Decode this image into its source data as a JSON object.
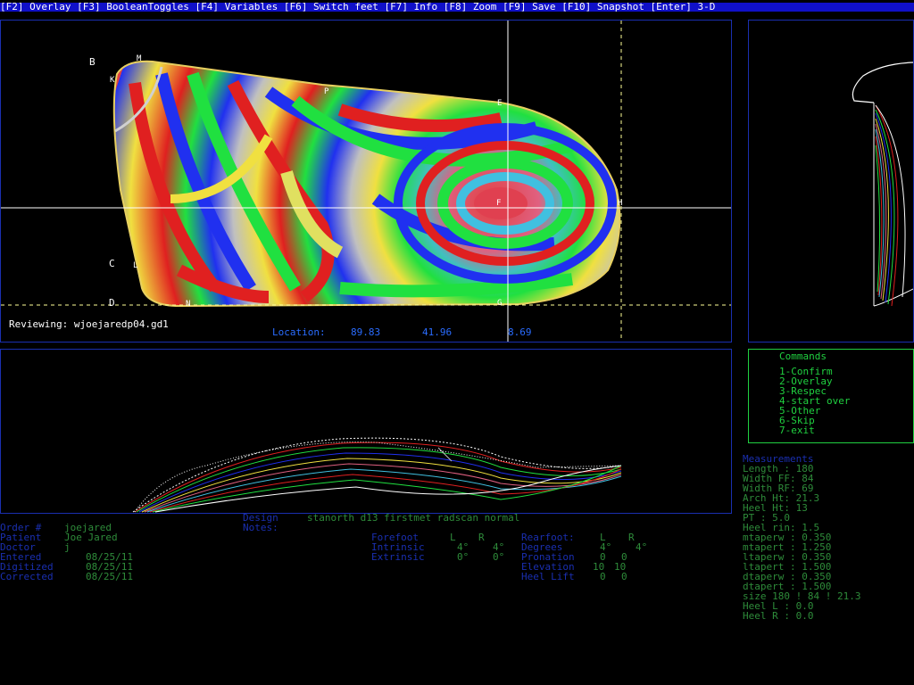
{
  "menubar": {
    "items": [
      "[F2] Overlay",
      "[F3] BooleanToggles",
      "[F4] Variables",
      "[F6] Switch feet",
      "[F7] Info",
      "[F8] Zoom",
      "[F9] Save",
      "[F10] Snapshot",
      "[Enter] 3-D"
    ]
  },
  "plantar": {
    "reviewing": "Reviewing: wjoejaredp04.gd1",
    "location_label": "Location:",
    "location_x": "89.83",
    "location_y": "41.96",
    "location_z": "8.69",
    "landmarks": [
      "B",
      "M",
      "K",
      "P",
      "E",
      "F",
      "H",
      "C",
      "L",
      "D",
      "N",
      "G"
    ]
  },
  "commands": {
    "title": "Commands",
    "items": [
      "1-Confirm",
      "2-Overlay",
      "3-Respec",
      "4-start over",
      "5-Other",
      "6-Skip",
      "7-exit"
    ]
  },
  "measurements": {
    "title": "Measurements",
    "lines": [
      "Length  :  180",
      "Width FF:  84",
      "Width RF:  69",
      "Arch Ht:  21.3",
      "Heel Ht:   13",
      "PT      : 5.0",
      "Heel rin: 1.5",
      "mtaperw : 0.350",
      "mtapert : 1.250",
      "ltaperw : 0.350",
      "ltapert : 1.500",
      "dtaperw : 0.350",
      "dtapert : 1.500",
      "size  180 ! 84 ! 21.3",
      "Heel L :  0.0",
      "Heel R :  0.0"
    ]
  },
  "order": {
    "labels": [
      "Order #",
      "Patient",
      "Doctor",
      "Entered",
      "Digitized",
      "Corrected"
    ],
    "values": [
      "joejared",
      "Joe Jared",
      "j",
      "08/25/11",
      "08/25/11",
      "08/25/11"
    ]
  },
  "design": {
    "label": "Design",
    "value": "stanorth d13 firstmet radscan normal",
    "notes_label": "Notes:"
  },
  "forefoot": {
    "header": "Forefoot",
    "col_l": "L",
    "col_r": "R",
    "rows": [
      {
        "label": "Intrinsic",
        "l": "4°",
        "r": "4°"
      },
      {
        "label": "Extrinsic",
        "l": "0°",
        "r": "0°"
      }
    ]
  },
  "rearfoot": {
    "header": "Rearfoot:",
    "col_l": "L",
    "col_r": "R",
    "rows": [
      {
        "label": "Degrees",
        "l": "4°",
        "r": "4°"
      },
      {
        "label": "Pronation",
        "l": "0",
        "r": "0"
      },
      {
        "label": "Elevation",
        "l": "10",
        "r": "10"
      },
      {
        "label": "Heel Lift",
        "l": "0",
        "r": "0"
      }
    ]
  }
}
